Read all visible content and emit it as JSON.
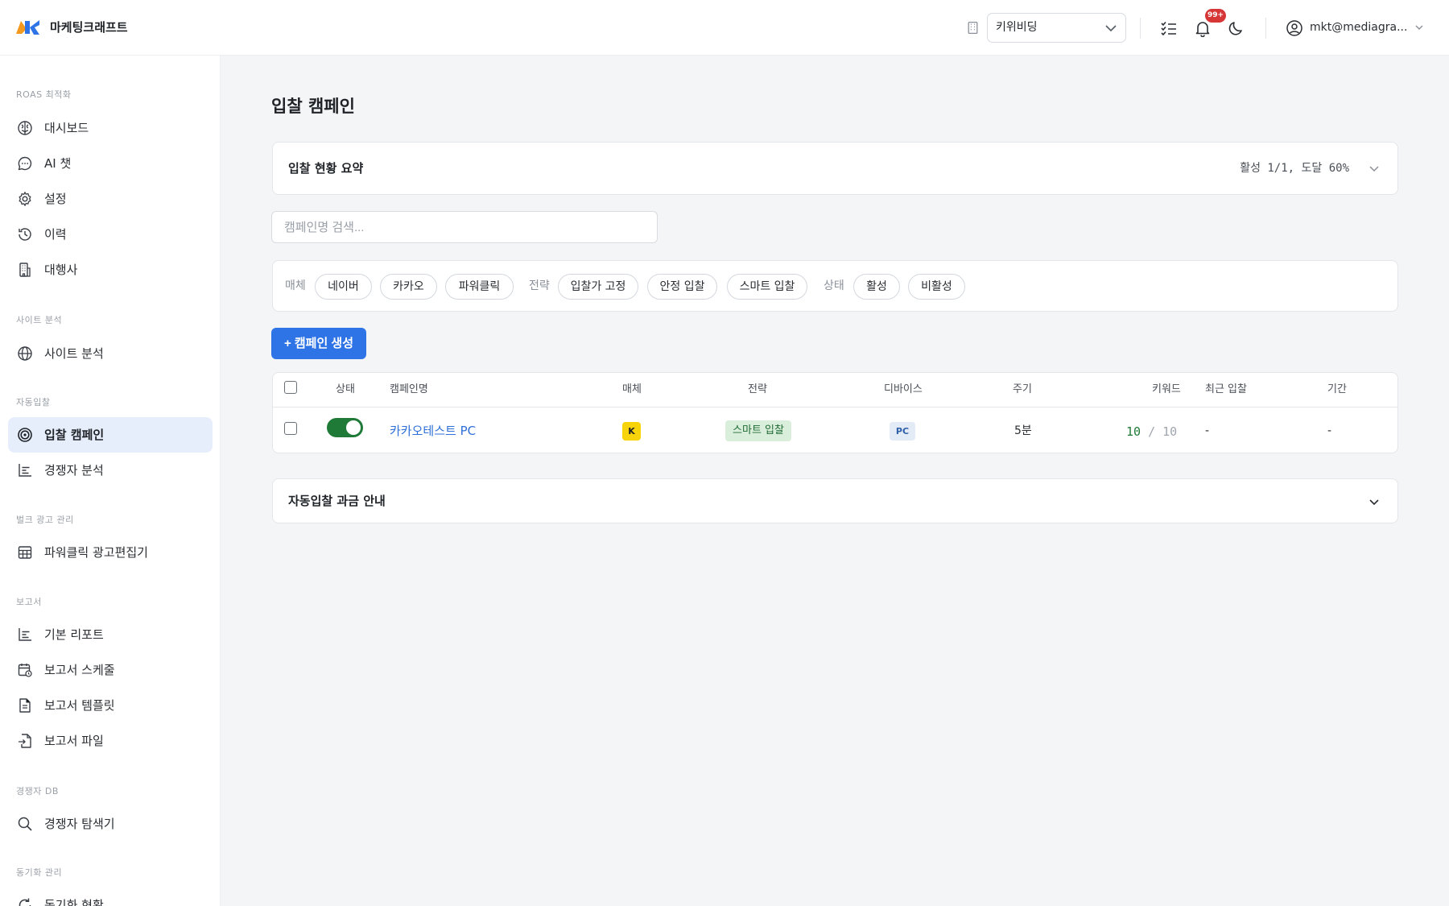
{
  "app": {
    "brand": "마케팅크래프트",
    "account_select": "키위비딩",
    "notification_badge": "99+",
    "user_email": "mkt@mediagra..."
  },
  "sidebar": {
    "sections": [
      {
        "title": "ROAS 최적화",
        "items": [
          {
            "label": "대시보드",
            "icon": "brain-icon"
          },
          {
            "label": "AI 챗",
            "icon": "chat-icon"
          },
          {
            "label": "설정",
            "icon": "gear-icon"
          },
          {
            "label": "이력",
            "icon": "history-icon"
          },
          {
            "label": "대행사",
            "icon": "building-icon"
          }
        ]
      },
      {
        "title": "사이트 분석",
        "items": [
          {
            "label": "사이트 분석",
            "icon": "globe-icon"
          }
        ]
      },
      {
        "title": "자동입찰",
        "items": [
          {
            "label": "입찰 캠페인",
            "icon": "target-icon",
            "active": true
          },
          {
            "label": "경쟁자 분석",
            "icon": "chart-icon"
          }
        ]
      },
      {
        "title": "벌크 광고 관리",
        "items": [
          {
            "label": "파워클릭 광고편집기",
            "icon": "table-icon"
          }
        ]
      },
      {
        "title": "보고서",
        "items": [
          {
            "label": "기본 리포트",
            "icon": "chart-icon"
          },
          {
            "label": "보고서 스케줄",
            "icon": "calendar-icon"
          },
          {
            "label": "보고서 템플릿",
            "icon": "file-icon"
          },
          {
            "label": "보고서 파일",
            "icon": "file-import-icon"
          }
        ]
      },
      {
        "title": "경쟁자 DB",
        "items": [
          {
            "label": "경쟁자 탐색기",
            "icon": "search-icon"
          }
        ]
      },
      {
        "title": "동기화 관리",
        "items": [
          {
            "label": "동기화 현황",
            "icon": "refresh-icon"
          }
        ]
      }
    ]
  },
  "main": {
    "page_title": "입찰 캠페인",
    "summary": {
      "title": "입찰 현황 요약",
      "status": "활성 1/1, 도달 60%"
    },
    "search": {
      "placeholder": "캠페인명 검색..."
    },
    "filters": {
      "media_label": "매체",
      "media": [
        "네이버",
        "카카오",
        "파워클릭"
      ],
      "strategy_label": "전략",
      "strategy": [
        "입찰가 고정",
        "안정 입찰",
        "스마트 입찰"
      ],
      "status_label": "상태",
      "status": [
        "활성",
        "비활성"
      ]
    },
    "create_button": "+ 캠페인 생성",
    "table": {
      "headers": {
        "status": "상태",
        "name": "캠페인명",
        "media": "매체",
        "strategy": "전략",
        "device": "디바이스",
        "cycle": "주기",
        "keywords": "키워드",
        "last_bid": "최근 입찰",
        "period": "기간"
      },
      "rows": [
        {
          "active": true,
          "name": "카카오테스트 PC",
          "media": "K",
          "strategy": "스마트 입찰",
          "device": "PC",
          "cycle": "5분",
          "keywords_reached": "10",
          "keywords_sep": "/",
          "keywords_total": "10",
          "last_bid": "-",
          "period": "-"
        }
      ]
    },
    "billing": {
      "title": "자동입찰 과금 안내"
    }
  },
  "colors": {
    "primary": "#2f74e6",
    "toggle_on": "#1f7a37",
    "kakao": "#f7d309",
    "badge": "#d63636",
    "active_nav_bg": "#e7eefb"
  }
}
